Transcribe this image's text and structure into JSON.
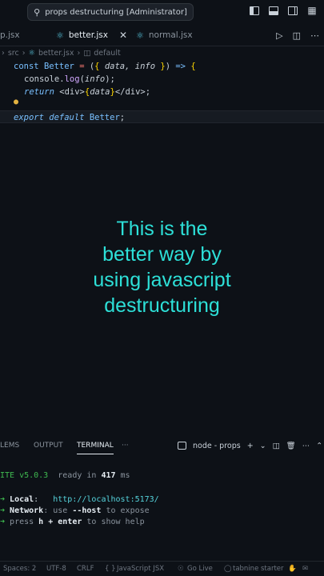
{
  "titlebar": {
    "search_text": "props destructuring [Administrator]"
  },
  "tabs": [
    {
      "label": "p.jsx"
    },
    {
      "label": "better.jsx"
    },
    {
      "label": "normal.jsx"
    }
  ],
  "breadcrumb": {
    "folder": "src",
    "file": "better.jsx",
    "symbol": "default"
  },
  "code": {
    "line1": {
      "kw": "const",
      "name": "Better",
      "eq": " = ",
      "p1": "(",
      "b1": "{",
      "params": " data, info ",
      "b2": "}",
      "p2": ")",
      "arrow": " => ",
      "ob": "{"
    },
    "line2": {
      "obj": "console",
      "dot": ".",
      "fn": "log",
      "p1": "(",
      "arg": "info",
      "p2": ");"
    },
    "line3": {
      "kw": "return",
      "tag1": " <div>",
      "b1": "{",
      "expr": "data",
      "b2": "}",
      "tag2": "</div>",
      "semi": ";"
    },
    "line5": {
      "kw1": "export",
      "kw2": " default",
      "name": " Better",
      "semi": ";"
    }
  },
  "overlay": {
    "line1": "This is the",
    "line2": "better way by",
    "line3": "using javascript",
    "line4": "destructuring"
  },
  "panel": {
    "tabs": [
      "LEMS",
      "OUTPUT",
      "TERMINAL"
    ],
    "more": "···",
    "terminal_name": "node - props"
  },
  "terminal": {
    "line1_a": "ITE v5.0.3",
    "line1_b": "  ready in ",
    "line1_c": "417",
    "line1_d": " ms",
    "local_label": "Local",
    "local_sep": ":   ",
    "local_url": "http://localhost:5173/",
    "network_label": "Network",
    "network_text": ": use ",
    "network_flag": "--host",
    "network_tail": " to expose",
    "help_a": "press ",
    "help_b": "h + enter",
    "help_c": " to show help"
  },
  "status": {
    "spaces": "Spaces: 2",
    "encoding": "UTF-8",
    "eol": "CRLF",
    "language": "JavaScript JSX",
    "golive": "Go Live",
    "tabnine": "tabnine starter"
  },
  "colors": {
    "overlay_text": "#2de0d8",
    "background": "#0d1117"
  }
}
